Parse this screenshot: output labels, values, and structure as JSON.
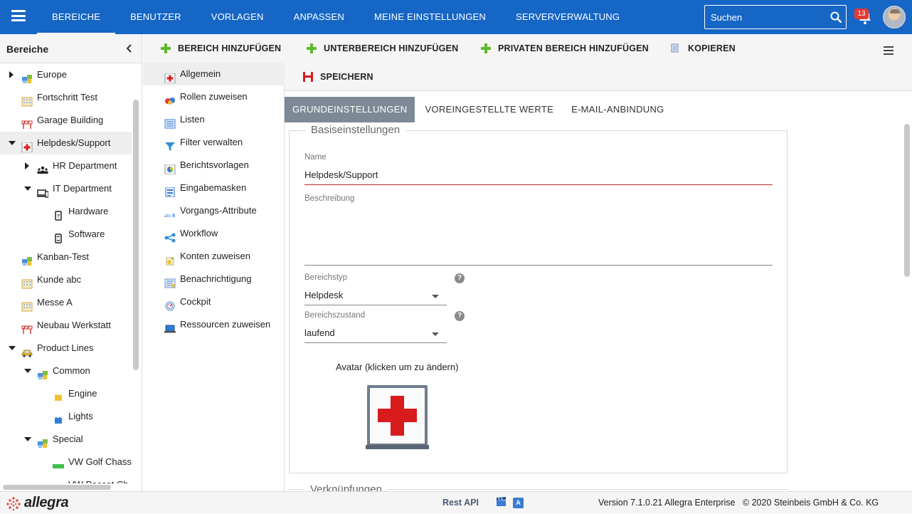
{
  "topnav": {
    "items": [
      "BEREICHE",
      "BENUTZER",
      "VORLAGEN",
      "ANPASSEN",
      "MEINE EINSTELLUNGEN",
      "SERVERVERWALTUNG"
    ],
    "active": "BEREICHE",
    "search_placeholder": "Suchen",
    "notification_count": "13",
    "accent": "#1666c5"
  },
  "sidebar": {
    "title": "Bereiche",
    "tree": [
      {
        "label": "Europe",
        "icon": "project-icon",
        "expander": "collapsed"
      },
      {
        "label": "Fortschritt Test",
        "icon": "building-icon",
        "expander": "none"
      },
      {
        "label": "Garage Building",
        "icon": "construction-icon",
        "expander": "none"
      },
      {
        "label": "Helpdesk/Support",
        "icon": "first-aid-icon",
        "expander": "expanded",
        "selected": true
      },
      {
        "label": "HR Department",
        "icon": "people-icon",
        "expander": "collapsed"
      },
      {
        "label": "IT Department",
        "icon": "devices-icon",
        "expander": "expanded"
      },
      {
        "label": "Hardware",
        "icon": "hardware-icon",
        "expander": "none"
      },
      {
        "label": "Software",
        "icon": "software-icon",
        "expander": "none"
      },
      {
        "label": "Kanban-Test",
        "icon": "project-icon",
        "expander": "none"
      },
      {
        "label": "Kunde abc",
        "icon": "building-icon",
        "expander": "none"
      },
      {
        "label": "Messe A",
        "icon": "building-icon",
        "expander": "none"
      },
      {
        "label": "Neubau Werkstatt",
        "icon": "construction-icon",
        "expander": "none"
      },
      {
        "label": "Product Lines",
        "icon": "car-icon",
        "expander": "expanded"
      },
      {
        "label": "Common",
        "icon": "project-icon",
        "expander": "expanded"
      },
      {
        "label": "Engine",
        "icon": "yellow-block-icon",
        "expander": "none"
      },
      {
        "label": "Lights",
        "icon": "blue-block-icon",
        "expander": "none"
      },
      {
        "label": "Special",
        "icon": "project-icon",
        "expander": "expanded"
      },
      {
        "label": "VW Golf Chassi",
        "icon": "green-bar-icon",
        "expander": "none"
      },
      {
        "label": "VW Passat Ch",
        "icon": "green-bar-icon",
        "expander": "none"
      }
    ]
  },
  "toolbar": {
    "add_area": "BEREICH HINZUFÜGEN",
    "add_subarea": "UNTERBEREICH HINZUFÜGEN",
    "add_private_area": "PRIVATEN BEREICH HINZUFÜGEN",
    "copy": "KOPIEREN",
    "save": "SPEICHERN"
  },
  "menu": {
    "items": [
      {
        "label": "Allgemein",
        "icon": "first-aid-icon",
        "selected": true
      },
      {
        "label": "Rollen zuweisen",
        "icon": "roles-icon"
      },
      {
        "label": "Listen",
        "icon": "list-icon"
      },
      {
        "label": "Filter verwalten",
        "icon": "filter-icon"
      },
      {
        "label": "Berichtsvorlagen",
        "icon": "report-icon"
      },
      {
        "label": "Eingabemasken",
        "icon": "form-icon"
      },
      {
        "label": "Vorgangs-Attribute",
        "icon": "attributes-icon"
      },
      {
        "label": "Workflow",
        "icon": "workflow-icon"
      },
      {
        "label": "Konten zuweisen",
        "icon": "accounts-icon"
      },
      {
        "label": "Benachrichtigung",
        "icon": "notification-icon"
      },
      {
        "label": "Cockpit",
        "icon": "cockpit-icon"
      },
      {
        "label": "Ressourcen zuweisen",
        "icon": "laptop-icon"
      }
    ]
  },
  "tabs": {
    "items": [
      "GRUNDEINSTELLUNGEN",
      "VOREINGESTELLTE WERTE",
      "E-MAIL-ANBINDUNG"
    ],
    "active": "GRUNDEINSTELLUNGEN"
  },
  "form": {
    "legend": "Basiseinstellungen",
    "name_label": "Name",
    "name_value": "Helpdesk/Support",
    "description_label": "Beschreibung",
    "description_value": "",
    "type_label": "Bereichstyp",
    "type_value": "Helpdesk",
    "state_label": "Bereichszustand",
    "state_value": "laufend",
    "help_glyph": "?",
    "avatar_caption": "Avatar (klicken um zu ändern)",
    "name_underline_color": "#c62828",
    "next_legend": "Verknüpfungen"
  },
  "footer": {
    "logo": "allegra",
    "rest_api": "Rest API",
    "ide_badge": "A",
    "version": "Version 7.1.0.21 Allegra Enterprise",
    "copyright": "© 2020 Steinbeis GmbH & Co. KG"
  }
}
